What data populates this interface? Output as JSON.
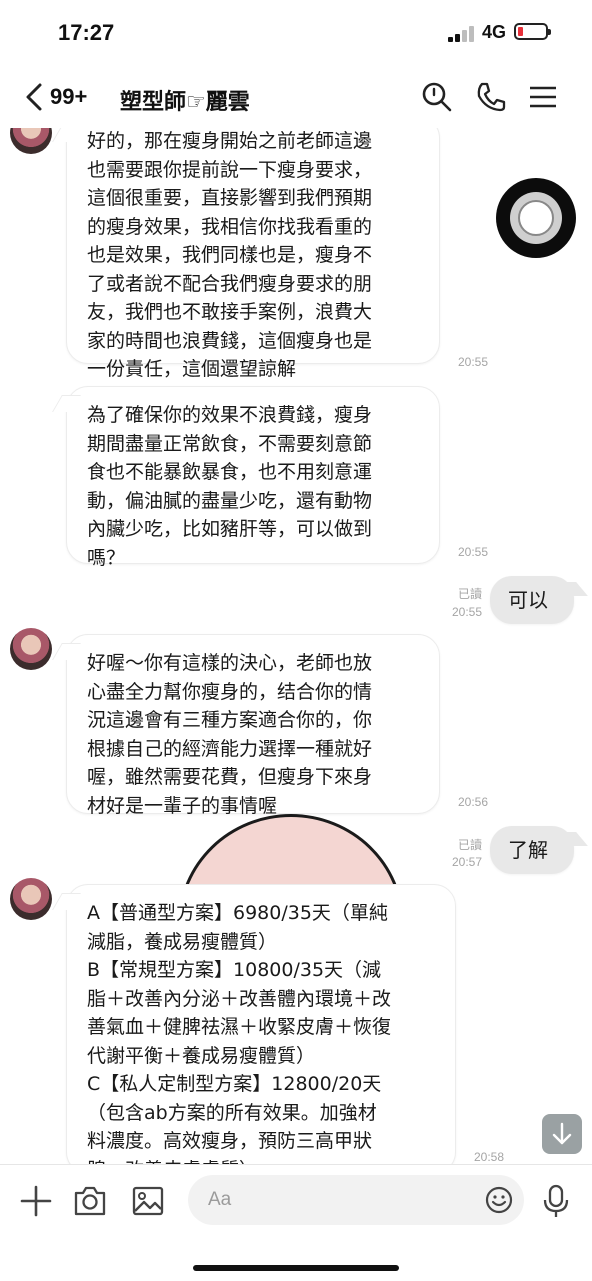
{
  "status": {
    "time": "17:27",
    "network": "4G"
  },
  "header": {
    "back_count": "99+",
    "title": "塑型師☞麗雲"
  },
  "messages": [
    {
      "side": "left",
      "text": "好的，那在瘦身開始之前老師這邊\n也需要跟你提前說一下瘦身要求，\n這個很重要，直接影響到我們預期\n的瘦身效果，我相信你找我看重的\n也是效果，我們同樣也是，瘦身不\n了或者說不配合我們瘦身要求的朋\n友，我們也不敢接手案例，浪費大\n家的時間也浪費錢，這個瘦身也是\n一份責任，這個還望諒解",
      "time": "20:55"
    },
    {
      "side": "left",
      "text": "為了確保你的效果不浪費錢，瘦身\n期間盡量正常飲食，不需要刻意節\n食也不能暴飲暴食，也不用刻意運\n動，偏油膩的盡量少吃，還有動物\n內臟少吃，比如豬肝等，可以做到\n嗎？",
      "time": "20:55"
    },
    {
      "side": "right",
      "text": "可以",
      "read": "已讀",
      "time": "20:55"
    },
    {
      "side": "left",
      "text": "好喔～你有這樣的決心，老師也放\n心盡全力幫你瘦身的，结合你的情\n況這邊會有三種方案適合你的，你\n根據自己的經濟能力選擇一種就好\n喔，雖然需要花費，但瘦身下來身\n材好是一輩子的事情喔",
      "time": "20:56"
    },
    {
      "side": "right",
      "text": "了解",
      "read": "已讀",
      "time": "20:57"
    },
    {
      "side": "left",
      "text": "A【普通型方案】6980/35天（單純\n減脂，養成易瘦體質）\nB【常規型方案】10800/35天（減\n脂＋改善內分泌＋改善體內環境＋改\n善氣血＋健脾祛濕＋收緊皮膚＋恢復\n代謝平衡＋養成易瘦體質）\nC【私人定制型方案】12800/20天\n（包含ab方案的所有效果。加強材\n料濃度。高效瘦身，預防三高甲狀\n腺。改善皮膚膚質）",
      "time": "20:58"
    }
  ],
  "input": {
    "placeholder": "Aa"
  },
  "icons": {
    "back": "chevron-left-icon",
    "search": "search-icon",
    "call": "phone-icon",
    "menu": "menu-icon",
    "plus": "plus-icon",
    "camera": "camera-icon",
    "image": "image-icon",
    "emoji": "emoji-icon",
    "mic": "microphone-icon",
    "scroll": "arrow-down-icon"
  },
  "colors": {
    "battery_low": "#e8303a",
    "my_bubble": "#e8e8e8",
    "timestamp": "#a5a5a5"
  }
}
